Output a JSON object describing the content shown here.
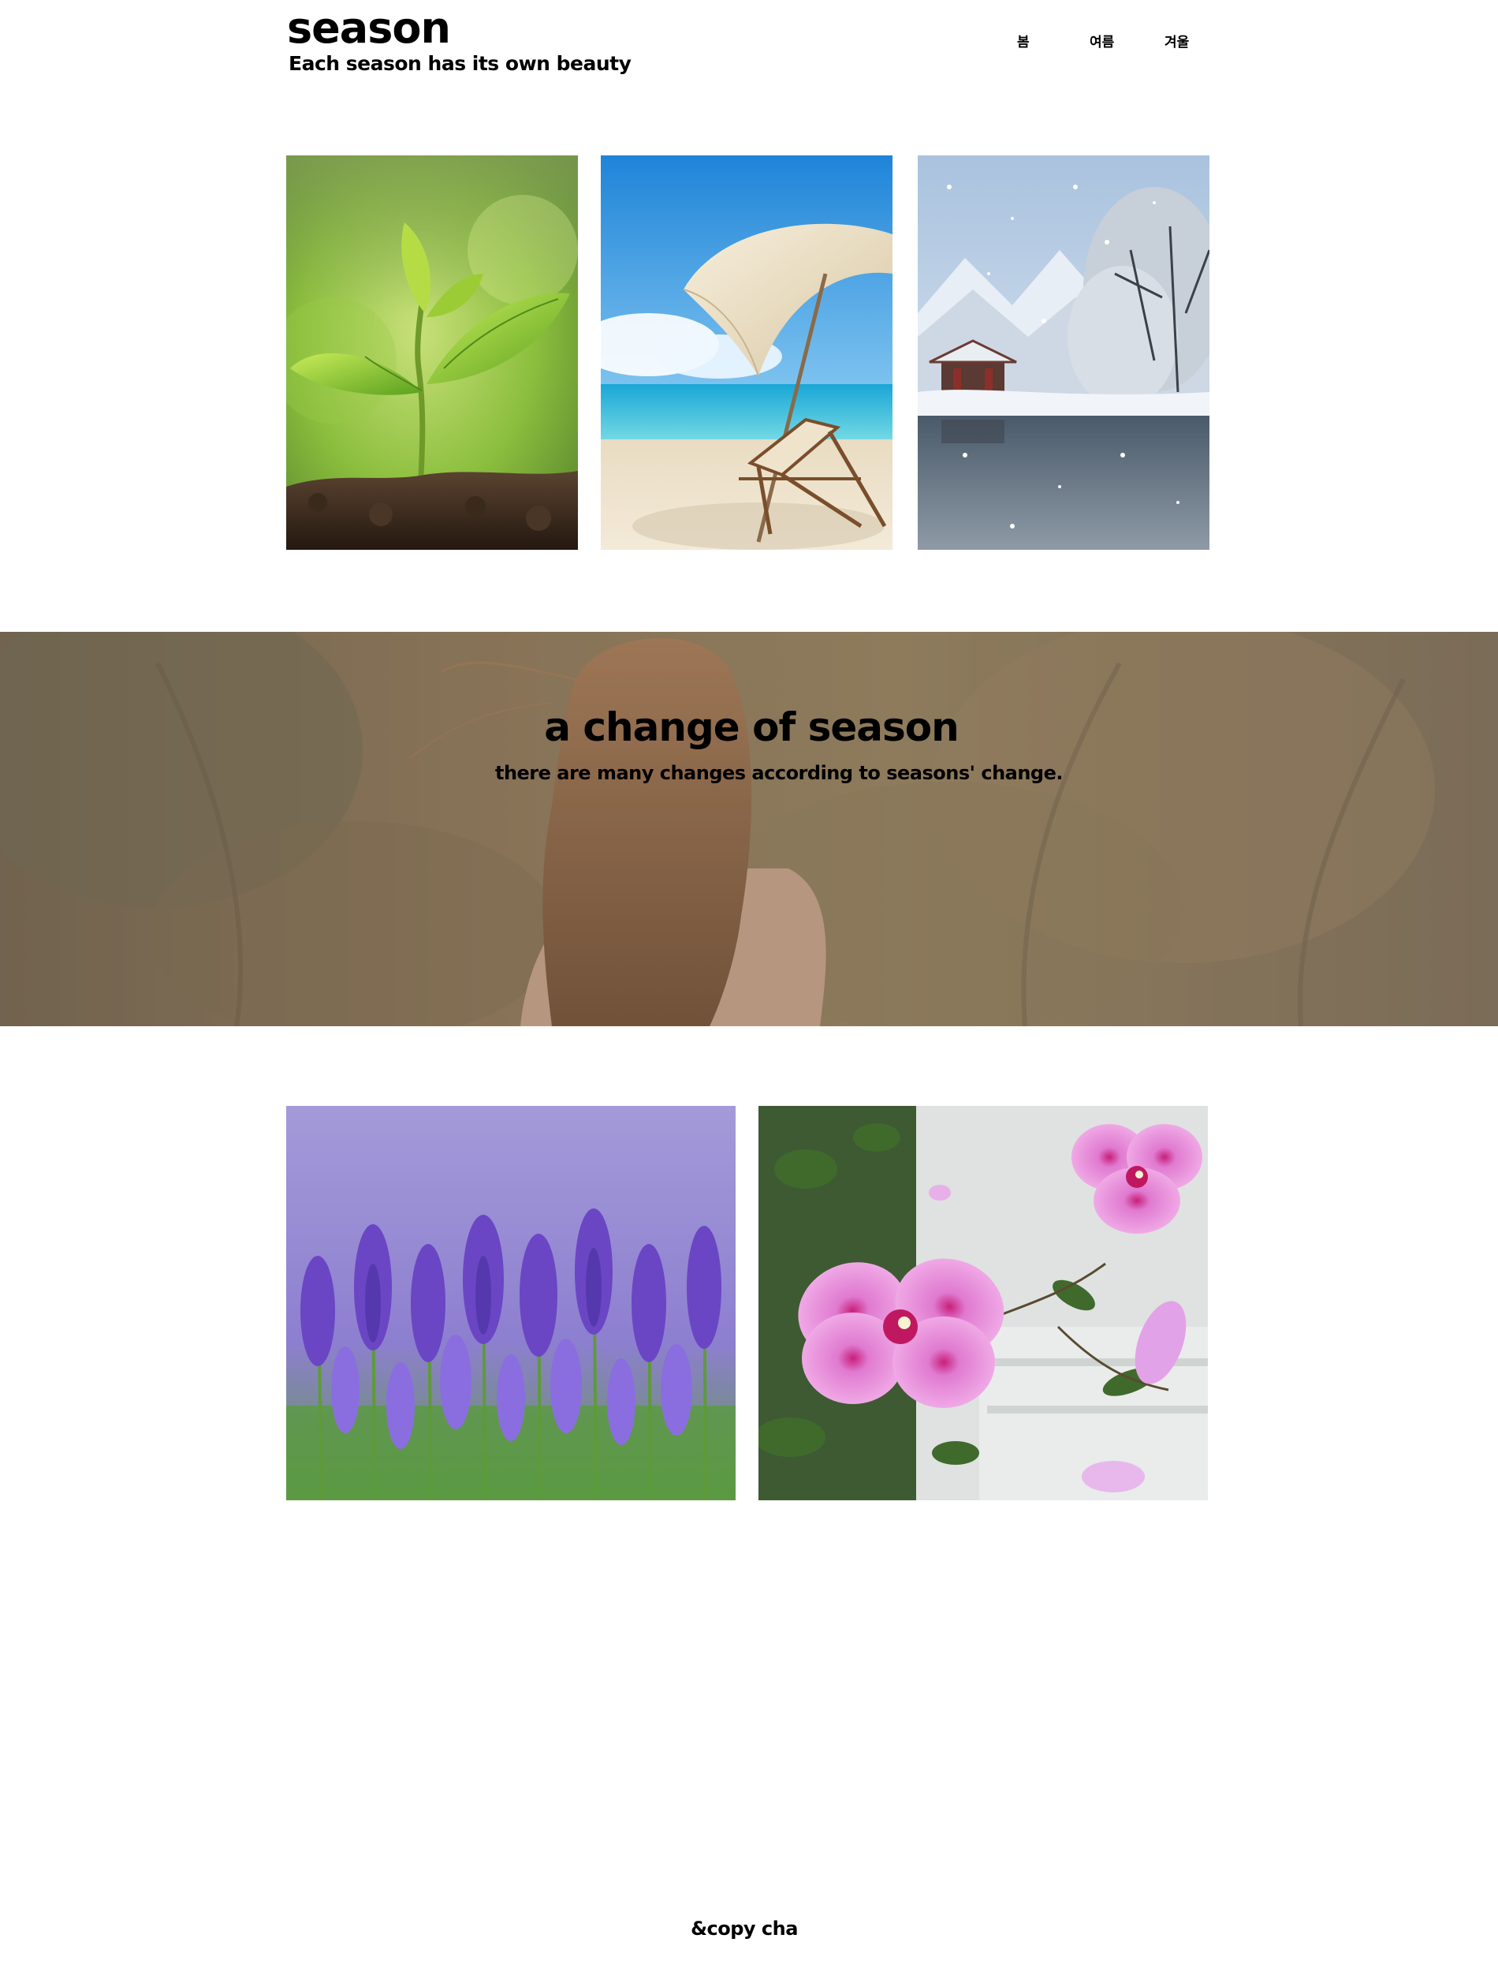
{
  "header": {
    "title": "season",
    "tagline": "Each season has its own beauty"
  },
  "nav": {
    "items": [
      {
        "label": "봄"
      },
      {
        "label": "여름"
      },
      {
        "label": "겨울"
      }
    ]
  },
  "gallery_top": {
    "images": [
      {
        "subject": "spring sprout in soil"
      },
      {
        "subject": "beach umbrella and deck chair"
      },
      {
        "subject": "snowy pavilion by a lake"
      }
    ]
  },
  "banner": {
    "title": "a change of season",
    "subtitle": "there are many changes according to seasons' change.",
    "background": "woman with long hair in autumn field"
  },
  "gallery_bottom": {
    "images": [
      {
        "subject": "lavender field"
      },
      {
        "subject": "pink hibiscus flowers"
      }
    ]
  },
  "footer": {
    "text": "&copy cha"
  },
  "colors": {
    "background": "#ffffff",
    "text": "#000000",
    "banner_overlay": "#7a6a58"
  }
}
